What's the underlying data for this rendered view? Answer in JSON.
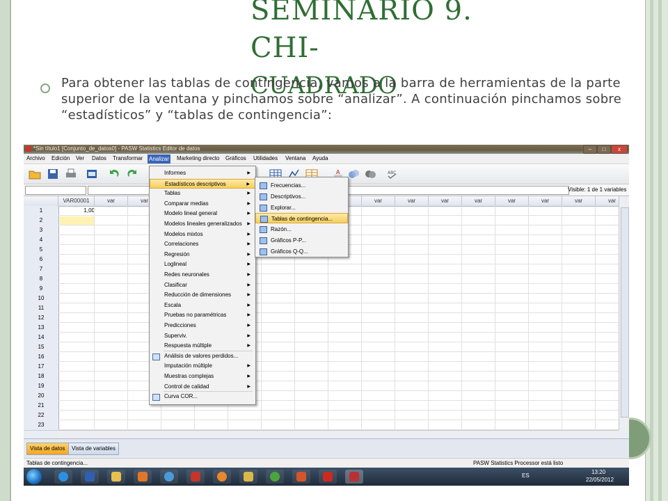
{
  "slide": {
    "title_line1": "SEMINARIO 9. CHI-",
    "title_line2": "CUADRADO",
    "body": "Para obtener las tablas de contingencia, vamos a la barra de herramientas de la parte superior de la ventana y pinchamos sobre “analizar”. A continuación pinchamos sobre “estadísticos” y “tablas de contingencia”:"
  },
  "window": {
    "title": "*Sin título1 [Conjunto_de_datos0] - PASW Statistics Editor de datos",
    "controls": [
      "–",
      "□",
      "x"
    ]
  },
  "menubar": [
    "Archivo",
    "Edición",
    "Ver",
    "Datos",
    "Transformar",
    "Analizar",
    "Marketing directo",
    "Gráficos",
    "Utilidades",
    "Ventana",
    "Ayuda"
  ],
  "visible_label": "Visible: 1 de 1 variables",
  "grid": {
    "first_col": "VAR00001",
    "other_col": "var",
    "first_value": "1,00",
    "rows": [
      "1",
      "2",
      "3",
      "4",
      "5",
      "6",
      "7",
      "8",
      "9",
      "10",
      "11",
      "12",
      "13",
      "14",
      "15",
      "16",
      "17",
      "18",
      "19",
      "20",
      "21",
      "22",
      "23"
    ]
  },
  "analyze_menu": [
    {
      "label": "Informes",
      "sub": true
    },
    {
      "label": "Estadísticos descriptivos",
      "sub": true,
      "highlight": true
    },
    {
      "label": "Tablas",
      "sub": true
    },
    {
      "label": "Comparar medias",
      "sub": true
    },
    {
      "label": "Modelo lineal general",
      "sub": true
    },
    {
      "label": "Modelos lineales generalizados",
      "sub": true
    },
    {
      "label": "Modelos mixtos",
      "sub": true
    },
    {
      "label": "Correlaciones",
      "sub": true
    },
    {
      "label": "Regresión",
      "sub": true
    },
    {
      "label": "Loglineal",
      "sub": true
    },
    {
      "label": "Redes neuronales",
      "sub": true
    },
    {
      "label": "Clasificar",
      "sub": true
    },
    {
      "label": "Reducción de dimensiones",
      "sub": true
    },
    {
      "label": "Escala",
      "sub": true
    },
    {
      "label": "Pruebas no paramétricas",
      "sub": true
    },
    {
      "label": "Predicciones",
      "sub": true
    },
    {
      "label": "Superviv.",
      "sub": true
    },
    {
      "label": "Respuesta múltiple",
      "sub": true
    },
    {
      "label": "Análisis de valores perdidos...",
      "sub": false,
      "icon": true
    },
    {
      "label": "Imputación múltiple",
      "sub": true
    },
    {
      "label": "Muestras complejas",
      "sub": true
    },
    {
      "label": "Control de calidad",
      "sub": true
    },
    {
      "label": "Curva COR...",
      "sub": false,
      "icon": true
    }
  ],
  "descriptives_menu": [
    {
      "label": "Frecuencias..."
    },
    {
      "label": "Descriptivos..."
    },
    {
      "label": "Explorar..."
    },
    {
      "label": "Tablas de contingencia...",
      "highlight": true
    },
    {
      "label": "Razón..."
    },
    {
      "label": "Gráficos P-P..."
    },
    {
      "label": "Gráficos Q-Q..."
    }
  ],
  "tabs": {
    "data_view": "Vista de datos",
    "variable_view": "Vista de variables"
  },
  "status": {
    "left": "Tablas de contingencia...",
    "right": "PASW Statistics Processor está listo"
  },
  "tray": {
    "lang": "ES",
    "time": "13:20",
    "date": "22/05/2012"
  },
  "colors": {
    "title_green": "#2f6e34",
    "menu_highlight": "#f7cf5c",
    "analyze_active": "#3a66b8"
  }
}
